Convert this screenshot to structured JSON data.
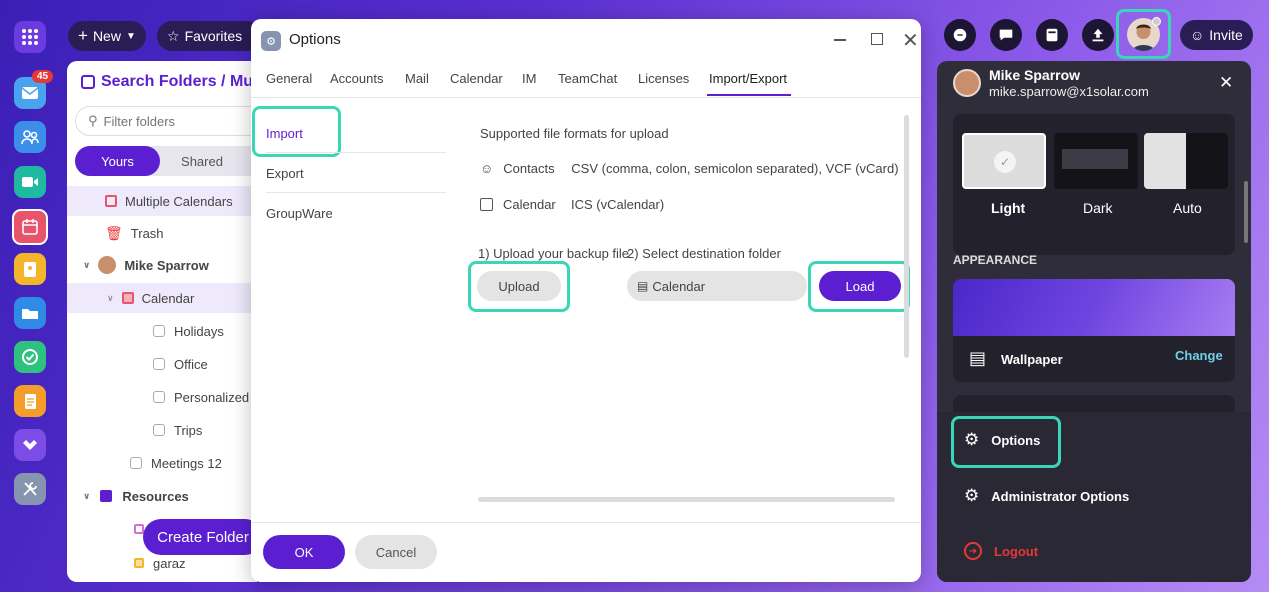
{
  "topbar": {
    "new_label": "New",
    "favorites_label": "Favorites",
    "invite_label": "Invite"
  },
  "rail": {
    "mail_badge": "45"
  },
  "folders": {
    "title": "Search Folders / Multi",
    "filter_placeholder": "Filter folders",
    "tabs": [
      "Yours",
      "Shared"
    ],
    "items": [
      "Multiple Calendars",
      "Trash",
      "Mike Sparrow",
      "Calendar",
      "Holidays",
      "Office",
      "Personalized",
      "Trips",
      "Meetings 12",
      "Resources",
      "garaz"
    ],
    "create_folder": "Create Folder"
  },
  "dialog": {
    "title": "Options",
    "tabs": [
      "General",
      "Accounts",
      "Mail",
      "Calendar",
      "IM",
      "TeamChat",
      "Licenses",
      "Import/Export"
    ],
    "nav": [
      "Import",
      "Export",
      "GroupWare"
    ],
    "supported_heading": "Supported file formats for upload",
    "contacts_label": "Contacts",
    "contacts_formats": "CSV (comma, colon, semicolon separated), VCF (vCard)",
    "calendar_label": "Calendar",
    "calendar_formats": "ICS (vCalendar)",
    "step1": "1) Upload your backup file",
    "step2": "2) Select destination folder",
    "upload_label": "Upload",
    "folder_value": "Calendar",
    "load_label": "Load",
    "ok_label": "OK",
    "cancel_label": "Cancel"
  },
  "profile": {
    "name": "Mike Sparrow",
    "email": "mike.sparrow@x1solar.com",
    "themes": [
      "Light",
      "Dark",
      "Auto"
    ],
    "appearance_heading": "APPEARANCE",
    "wallpaper_label": "Wallpaper",
    "change_label": "Change",
    "options_label": "Options",
    "admin_label": "Administrator Options",
    "logout_label": "Logout"
  },
  "colors": {
    "accent": "#5b1fd1",
    "highlight": "#3ad6b8",
    "logout": "#e53935"
  }
}
